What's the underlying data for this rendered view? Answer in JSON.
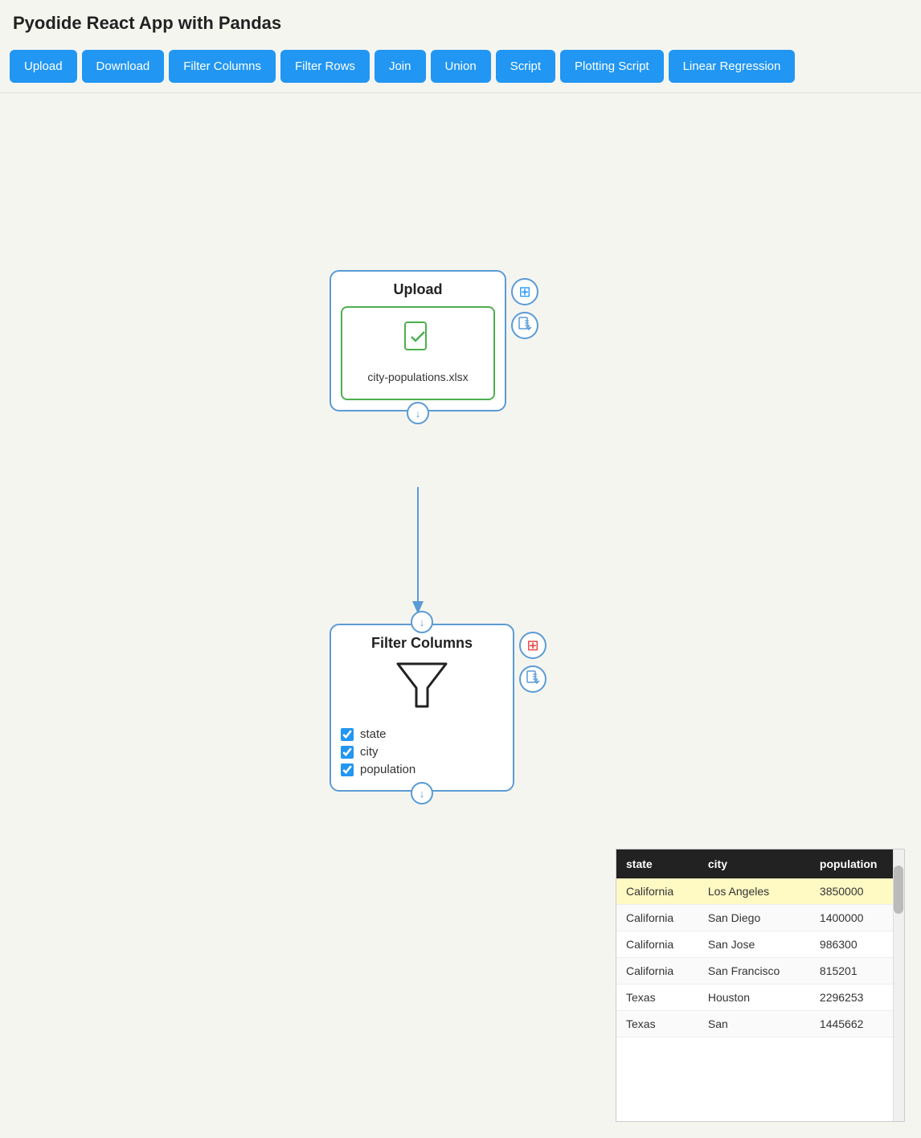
{
  "app": {
    "title": "Pyodide React App with Pandas"
  },
  "toolbar": {
    "buttons": [
      {
        "label": "Upload",
        "id": "upload"
      },
      {
        "label": "Download",
        "id": "download"
      },
      {
        "label": "Filter Columns",
        "id": "filter-columns"
      },
      {
        "label": "Filter Rows",
        "id": "filter-rows"
      },
      {
        "label": "Join",
        "id": "join"
      },
      {
        "label": "Union",
        "id": "union"
      },
      {
        "label": "Script",
        "id": "script"
      },
      {
        "label": "Plotting Script",
        "id": "plotting-script"
      },
      {
        "label": "Linear Regression",
        "id": "linear-regression"
      }
    ]
  },
  "upload_node": {
    "title": "Upload",
    "filename": "city-populations.xlsx",
    "table_icon": "⊞",
    "download_icon": "⬇"
  },
  "filter_node": {
    "title": "Filter Columns",
    "checkboxes": [
      {
        "label": "state",
        "checked": true
      },
      {
        "label": "city",
        "checked": true
      },
      {
        "label": "population",
        "checked": true
      }
    ]
  },
  "table": {
    "headers": [
      "state",
      "city",
      "population"
    ],
    "rows": [
      {
        "state": "California",
        "city": "Los Angeles",
        "population": "3850000",
        "highlighted": true
      },
      {
        "state": "California",
        "city": "San Diego",
        "population": "1400000",
        "highlighted": false
      },
      {
        "state": "California",
        "city": "San Jose",
        "population": "986300",
        "highlighted": false
      },
      {
        "state": "California",
        "city": "San Francisco",
        "population": "815201",
        "highlighted": false
      },
      {
        "state": "Texas",
        "city": "Houston",
        "population": "2296253",
        "highlighted": false
      },
      {
        "state": "Texas",
        "city": "San",
        "population": "1445662",
        "highlighted": false
      }
    ]
  },
  "icons": {
    "arrow_down": "↓",
    "check": "✓",
    "grid": "⊞",
    "download_file": "⬇"
  }
}
